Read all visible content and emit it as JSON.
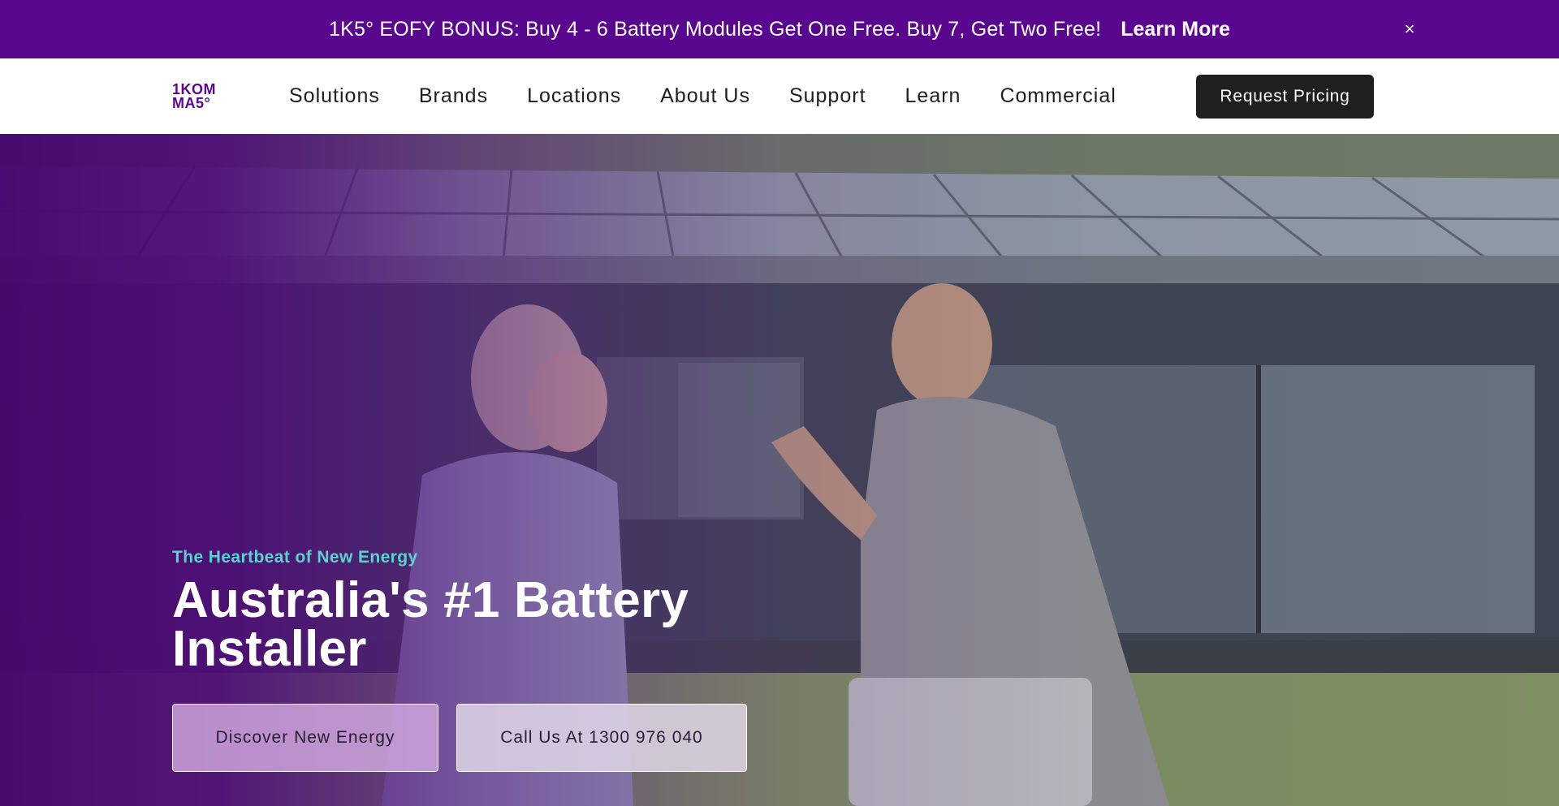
{
  "promo": {
    "text": "1K5° EOFY BONUS: Buy 4 - 6 Battery Modules Get One Free. Buy 7, Get Two Free!",
    "link_label": "Learn More",
    "close_glyph": "×"
  },
  "header": {
    "logo": {
      "line1": "1KOM",
      "line2": "MA5°"
    },
    "nav": [
      {
        "label": "Solutions"
      },
      {
        "label": "Brands"
      },
      {
        "label": "Locations"
      },
      {
        "label": "About Us"
      },
      {
        "label": "Support"
      },
      {
        "label": "Learn"
      },
      {
        "label": "Commercial"
      }
    ],
    "cta_label": "Request Pricing"
  },
  "hero": {
    "tagline": "The Heartbeat of New Energy",
    "title": "Australia's #1 Battery Installer",
    "buttons": {
      "discover": "Discover New Energy",
      "call": "Call Us At 1300 976 040"
    }
  },
  "colors": {
    "brand_purple": "#5a078f",
    "accent_teal": "#5ad3cf",
    "dark_button": "#1f1f1f"
  }
}
